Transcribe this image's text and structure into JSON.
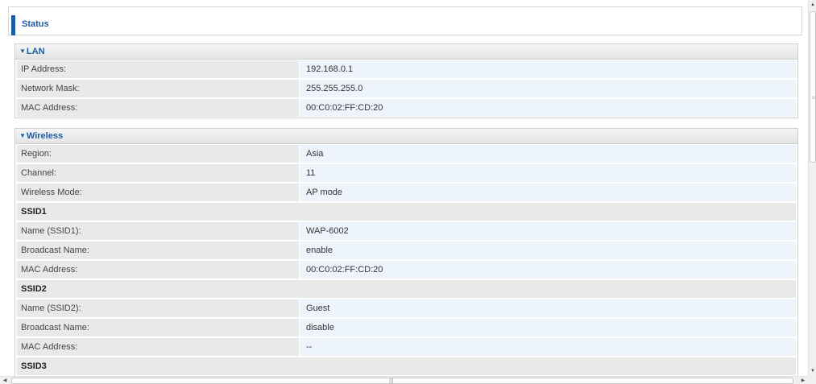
{
  "header": {
    "title": "Status"
  },
  "lan": {
    "title": "LAN",
    "rows": [
      {
        "label": "IP Address:",
        "value": "192.168.0.1"
      },
      {
        "label": "Network Mask:",
        "value": "255.255.255.0"
      },
      {
        "label": "MAC Address:",
        "value": "00:C0:02:FF:CD:20"
      }
    ]
  },
  "wireless": {
    "title": "Wireless",
    "rows": [
      {
        "label": "Region:",
        "value": "Asia"
      },
      {
        "label": "Channel:",
        "value": "11"
      },
      {
        "label": "Wireless Mode:",
        "value": "AP mode"
      }
    ],
    "ssid1": {
      "title": "SSID1",
      "rows": [
        {
          "label": "Name (SSID1):",
          "value": "WAP-6002"
        },
        {
          "label": "Broadcast Name:",
          "value": "enable"
        },
        {
          "label": "MAC Address:",
          "value": "00:C0:02:FF:CD:20"
        }
      ]
    },
    "ssid2": {
      "title": "SSID2",
      "rows": [
        {
          "label": "Name (SSID2):",
          "value": "Guest"
        },
        {
          "label": "Broadcast Name:",
          "value": "disable"
        },
        {
          "label": "MAC Address:",
          "value": "--"
        }
      ]
    },
    "ssid3": {
      "title": "SSID3"
    }
  },
  "scrollbar": {
    "up_icon": "scroll-up-arrow",
    "down_icon": "scroll-down-arrow",
    "left_icon": "scroll-left-arrow",
    "right_icon": "scroll-right-arrow"
  },
  "colors": {
    "accent": "#1a5ca8",
    "label_bg": "#e9e9e9",
    "value_bg": "#eef4fc"
  }
}
